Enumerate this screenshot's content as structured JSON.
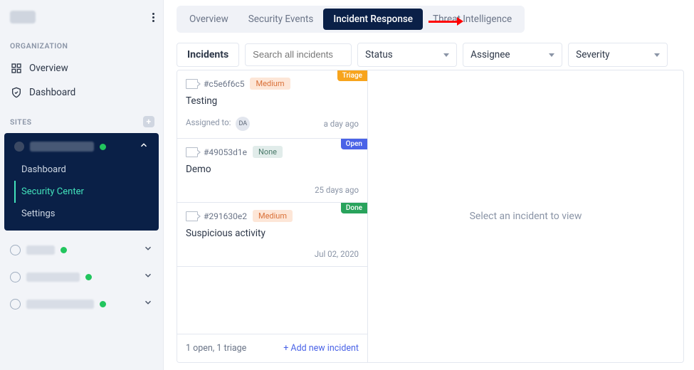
{
  "sidebar": {
    "organization_label": "ORGANIZATION",
    "org_items": [
      {
        "label": "Overview"
      },
      {
        "label": "Dashboard"
      }
    ],
    "sites_label": "SITES",
    "active_site": {
      "sub_items": [
        {
          "label": "Dashboard"
        },
        {
          "label": "Security Center"
        },
        {
          "label": "Settings"
        }
      ]
    }
  },
  "tabs": {
    "items": [
      {
        "label": "Overview"
      },
      {
        "label": "Security Events"
      },
      {
        "label": "Incident Response"
      },
      {
        "label": "Threat Intelligence"
      }
    ],
    "active_index": 2
  },
  "toolbar": {
    "title": "Incidents",
    "search_placeholder": "Search all incidents",
    "status_label": "Status",
    "assignee_label": "Assignee",
    "severity_label": "Severity"
  },
  "incidents": [
    {
      "id": "#c5e6f6c5",
      "severity": "Medium",
      "severity_class": "sev-medium",
      "status": "Triage",
      "status_class": "chip-triage",
      "title": "Testing",
      "assigned_prefix": "Assigned to:",
      "assigned_initials": "DA",
      "time": "a day ago"
    },
    {
      "id": "#49053d1e",
      "severity": "None",
      "severity_class": "sev-none",
      "status": "Open",
      "status_class": "chip-open",
      "title": "Demo",
      "assigned_prefix": "",
      "assigned_initials": "",
      "time": "25 days ago"
    },
    {
      "id": "#291630e2",
      "severity": "Medium",
      "severity_class": "sev-medium",
      "status": "Done",
      "status_class": "chip-done",
      "title": "Suspicious activity",
      "assigned_prefix": "",
      "assigned_initials": "",
      "time": "Jul 02, 2020"
    }
  ],
  "list_footer": {
    "summary": "1 open, 1 triage",
    "add_label": "+ Add new incident"
  },
  "detail_placeholder": "Select an incident to view"
}
